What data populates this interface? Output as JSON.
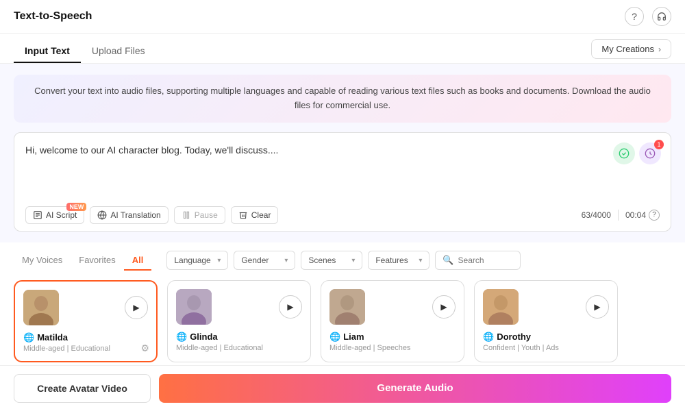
{
  "header": {
    "title": "Text-to-Speech",
    "help_icon": "?",
    "headphones_icon": "🎧"
  },
  "tabs": {
    "items": [
      {
        "label": "Input Text",
        "active": true
      },
      {
        "label": "Upload Files",
        "active": false
      }
    ],
    "creations_label": "My Creations"
  },
  "description": "Convert your text into audio files, supporting multiple languages and capable of reading various text files such as books and documents. Download the audio files for commercial use.",
  "editor": {
    "text": "Hi, welcome to our AI character blog. Today, we'll discuss....│",
    "char_count": "63/4000",
    "time": "00:04",
    "toolbar": {
      "ai_script_label": "AI Script",
      "ai_script_badge": "NEW",
      "ai_translation_label": "AI Translation",
      "pause_label": "Pause",
      "clear_label": "Clear"
    }
  },
  "voice_section": {
    "tabs": [
      {
        "label": "My Voices",
        "active": false
      },
      {
        "label": "Favorites",
        "active": false
      },
      {
        "label": "All",
        "active": true
      }
    ],
    "filters": {
      "language_label": "Language",
      "gender_label": "Gender",
      "scenes_label": "Scenes",
      "features_label": "Features",
      "search_placeholder": "Search"
    },
    "voices": [
      {
        "name": "Matilda",
        "desc": "Middle-aged | Educational",
        "selected": true,
        "avatar_class": "avatar-matilda"
      },
      {
        "name": "Glinda",
        "desc": "Middle-aged | Educational",
        "selected": false,
        "avatar_class": "avatar-glinda"
      },
      {
        "name": "Liam",
        "desc": "Middle-aged | Speeches",
        "selected": false,
        "avatar_class": "avatar-liam"
      },
      {
        "name": "Dorothy",
        "desc": "Confident | Youth | Ads",
        "selected": false,
        "avatar_class": "avatar-dorothy"
      }
    ]
  },
  "bottom_bar": {
    "create_avatar_label": "Create Avatar Video",
    "generate_audio_label": "Generate Audio"
  }
}
